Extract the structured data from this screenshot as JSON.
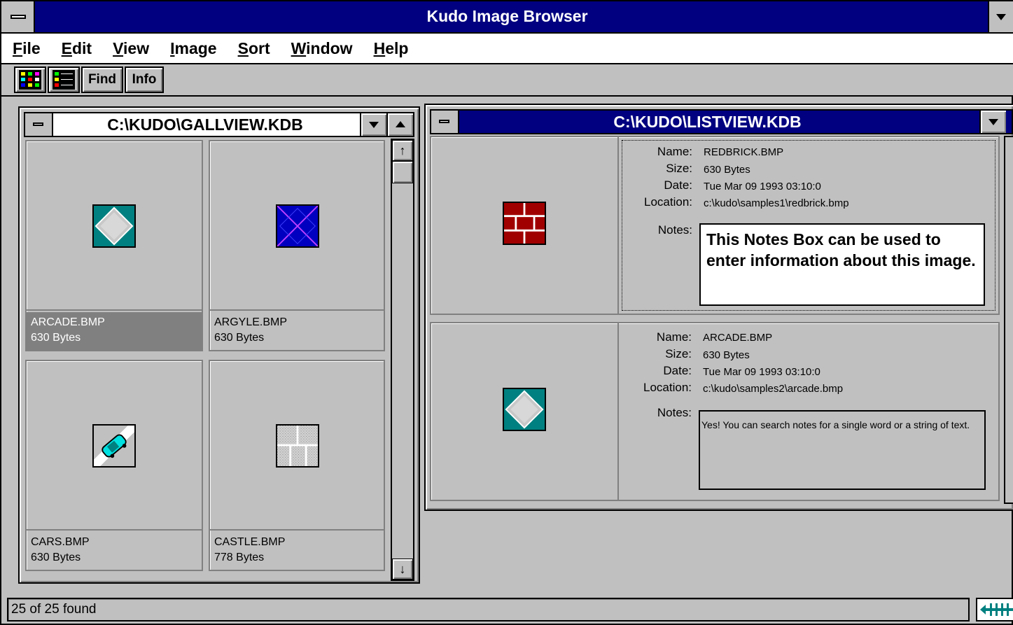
{
  "app": {
    "title": "Kudo Image Browser"
  },
  "menu": [
    {
      "label": "File",
      "key": "F",
      "rest": "ile"
    },
    {
      "label": "Edit",
      "key": "E",
      "rest": "dit"
    },
    {
      "label": "View",
      "key": "V",
      "rest": "iew"
    },
    {
      "label": "Image",
      "key": "I",
      "rest": "mage"
    },
    {
      "label": "Sort",
      "key": "S",
      "rest": "ort"
    },
    {
      "label": "Window",
      "key": "W",
      "rest": "indow"
    },
    {
      "label": "Help",
      "key": "H",
      "rest": "elp"
    }
  ],
  "toolbar": {
    "gallery_icon": "gallery-view-icon",
    "list_icon": "list-view-icon",
    "find_label": "Find",
    "info_label": "Info"
  },
  "gallery": {
    "title": "C:\\KUDO\\GALLVIEW.KDB",
    "items": [
      {
        "name": "ARCADE.BMP",
        "size": "630 Bytes",
        "selected": true,
        "icon": "arcade-thumbnail-icon"
      },
      {
        "name": "ARGYLE.BMP",
        "size": "630 Bytes",
        "selected": false,
        "icon": "argyle-thumbnail-icon"
      },
      {
        "name": "CARS.BMP",
        "size": "630 Bytes",
        "selected": false,
        "icon": "car-thumbnail-icon"
      },
      {
        "name": "CASTLE.BMP",
        "size": "778 Bytes",
        "selected": false,
        "icon": "castle-thumbnail-icon"
      }
    ]
  },
  "listview": {
    "title": "C:\\KUDO\\LISTVIEW.KDB",
    "labels": {
      "name": "Name:",
      "size": "Size:",
      "date": "Date:",
      "location": "Location:",
      "notes": "Notes:"
    },
    "records": [
      {
        "name": "REDBRICK.BMP",
        "size": "630 Bytes",
        "date": "Tue Mar 09 1993 03:10:0",
        "location": "c:\\kudo\\samples1\\redbrick.bmp",
        "notes": "This Notes Box can be used to enter information about this image."
      },
      {
        "name": "ARCADE.BMP",
        "size": "630 Bytes",
        "date": "Tue Mar 09 1993 03:10:0",
        "location": "c:\\kudo\\samples2\\arcade.bmp",
        "notes": "Yes!  You can search notes for a single word or a string of text."
      }
    ]
  },
  "status": {
    "text": "25 of 25 found"
  },
  "colors": {
    "titlebar": "#000080",
    "face": "#c0c0c0",
    "teal": "#008080",
    "selected": "#808080"
  }
}
